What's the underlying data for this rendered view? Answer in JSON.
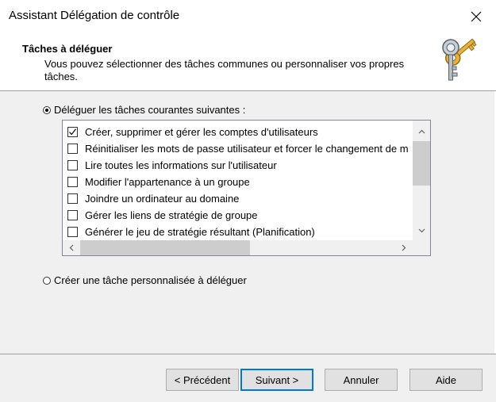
{
  "window": {
    "title": "Assistant Délégation de contrôle",
    "close_icon": "close-icon"
  },
  "header": {
    "title": "Tâches à déléguer",
    "description": "Vous pouvez sélectionner des tâches communes ou personnaliser vos propres tâches.",
    "icon": "keys-icon"
  },
  "options": {
    "common_label": "Déléguer les tâches courantes suivantes :",
    "custom_label": "Créer une tâche personnalisée à déléguer",
    "selected": "common"
  },
  "tasks": [
    {
      "label": "Créer, supprimer et gérer les comptes d'utilisateurs",
      "checked": true
    },
    {
      "label": "Réinitialiser les mots de passe utilisateur et forcer le changement de m",
      "checked": false
    },
    {
      "label": "Lire toutes les informations sur l'utilisateur",
      "checked": false
    },
    {
      "label": "Modifier l'appartenance à un groupe",
      "checked": false
    },
    {
      "label": "Joindre un ordinateur au domaine",
      "checked": false
    },
    {
      "label": "Gérer les liens de stratégie de groupe",
      "checked": false
    },
    {
      "label": "Générer le jeu de stratégie résultant (Planification)",
      "checked": false
    }
  ],
  "buttons": {
    "back": "< Précédent",
    "next": "Suivant >",
    "cancel": "Annuler",
    "help": "Aide"
  },
  "colors": {
    "accent": "#0078d7",
    "panel": "#f0f0f0",
    "button": "#e1e1e1"
  }
}
